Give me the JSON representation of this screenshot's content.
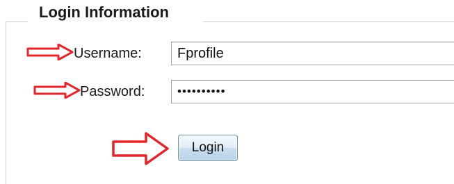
{
  "login_form": {
    "legend": "Login Information",
    "username": {
      "label": "Username:",
      "value": "Fprofile"
    },
    "password": {
      "label": "Password:",
      "value": "••••••••••"
    },
    "login_button_label": "Login"
  },
  "annotation": {
    "arrow_color": "#e3262b",
    "arrow_icon": "right-arrow-icon"
  }
}
